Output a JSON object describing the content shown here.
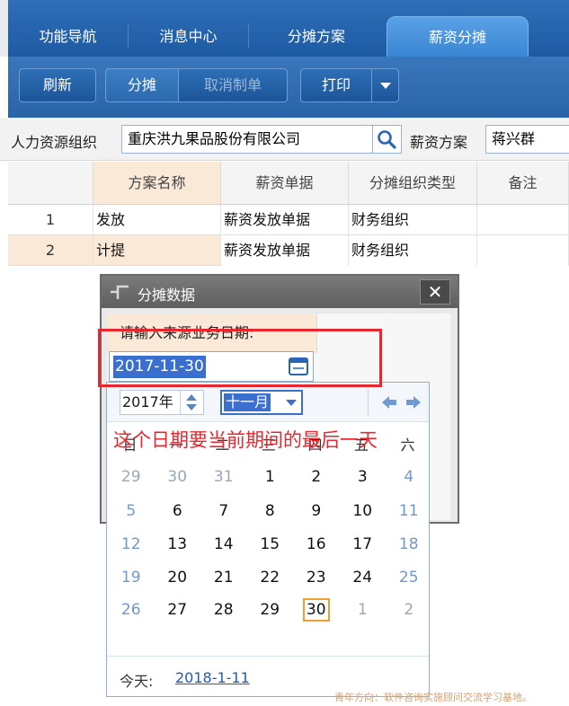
{
  "nav_tabs": [
    {
      "label": "功能导航"
    },
    {
      "label": "消息中心"
    },
    {
      "label": "分摊方案"
    },
    {
      "label": "薪资分摊"
    }
  ],
  "toolbar": {
    "refresh": "刷新",
    "allocate": "分摊",
    "cancel_voucher": "取消制单",
    "print": "打印"
  },
  "query": {
    "hr_org_label": "人力资源组织",
    "hr_org_value": "重庆洪九果品股份有限公司",
    "plan_label": "薪资方案",
    "plan_value": "蒋兴群"
  },
  "grid": {
    "headers": [
      "方案名称",
      "薪资单据",
      "分摊组织类型",
      "备注"
    ],
    "rows": [
      {
        "no": "1",
        "name": "发放",
        "doc": "薪资发放单据",
        "org_type": "财务组织",
        "remark": ""
      },
      {
        "no": "2",
        "name": "计提",
        "doc": "薪资发放单据",
        "org_type": "财务组织",
        "remark": ""
      }
    ]
  },
  "dialog": {
    "title": "分摊数据",
    "prompt": "请输入来源业务日期:",
    "date_value": "2017-11-30"
  },
  "calendar": {
    "year": "2017年",
    "month": "十一月",
    "weekdays": [
      "日",
      "一",
      "二",
      "三",
      "四",
      "五",
      "六"
    ],
    "weeks": [
      [
        "29",
        "30",
        "31",
        "1",
        "2",
        "3",
        "4"
      ],
      [
        "5",
        "6",
        "7",
        "8",
        "9",
        "10",
        "11"
      ],
      [
        "12",
        "13",
        "14",
        "15",
        "16",
        "17",
        "18"
      ],
      [
        "19",
        "20",
        "21",
        "22",
        "23",
        "24",
        "25"
      ],
      [
        "26",
        "27",
        "28",
        "29",
        "30",
        "1",
        "2"
      ]
    ],
    "selected_day": "30",
    "today_label": "今天:",
    "today_value": "2018-1-11"
  },
  "annotation": "这个日期要当前期间的最后一天",
  "watermark": "青年方向：软件咨询实施顾问交流学习基地。",
  "colors": {
    "accent_blue": "#2f6fb8",
    "annotation_red": "#e8262e",
    "selected_border": "#f0a030"
  }
}
